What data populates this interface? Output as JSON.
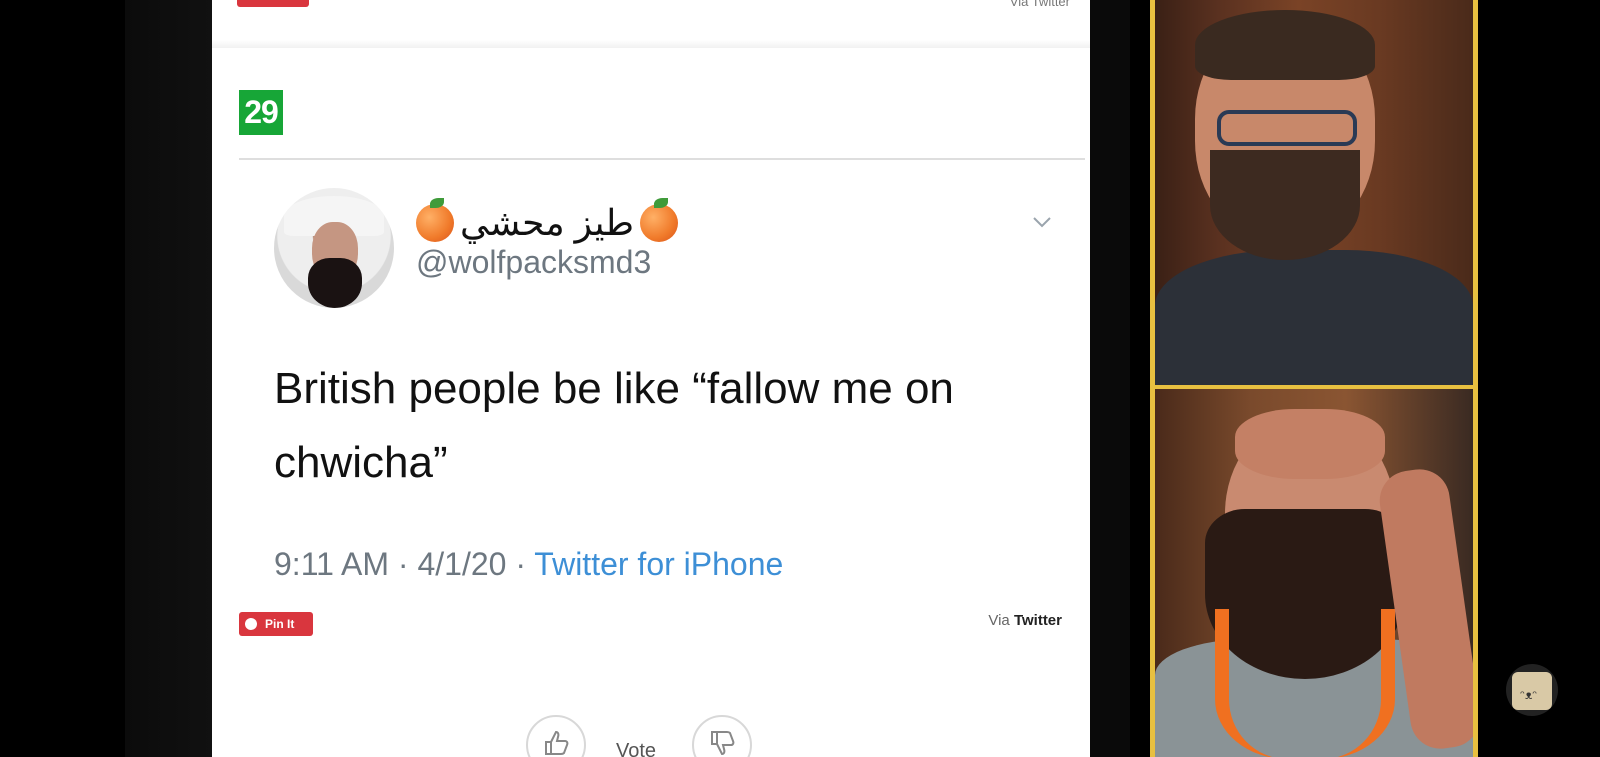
{
  "previous_item": {
    "pin_label": "Pin It",
    "via_text": "Via Twitter"
  },
  "item_number": "29",
  "tweet": {
    "display_name": "طيز محشي",
    "handle": "@wolfpacksmd3",
    "text": "British people be like “fallow me on chwicha”",
    "time": "9:11 AM",
    "date": "4/1/20",
    "source": "Twitter for iPhone",
    "separator": "·"
  },
  "actions": {
    "pin_label": "Pin It",
    "via_prefix": "Via",
    "via_source": "Twitter",
    "vote_label": "Vote"
  },
  "icons": {
    "chevron": "chevron-down-icon",
    "pin": "pin-dot-icon",
    "upvote": "thumbs-up-icon",
    "downvote": "thumbs-down-icon",
    "emoji": "peach-emoji-icon",
    "channel": "channel-avatar-icon"
  },
  "colors": {
    "badge_green": "#17a637",
    "pin_red": "#d9363e",
    "link_blue": "#3d8fd6",
    "cam_frame": "#e8c040"
  }
}
